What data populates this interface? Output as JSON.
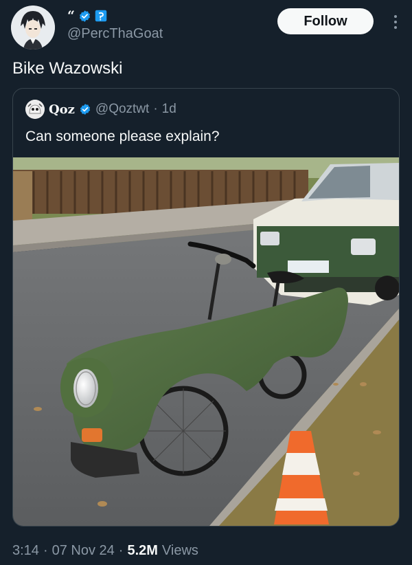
{
  "post": {
    "author_handle": "@PercThaGoat",
    "badge_glyph": "“",
    "follow_label": "Follow",
    "text": "Bike Wazowski",
    "avatar_icon": "anime-character-avatar",
    "verified_icon": "verified-badge-icon",
    "affiliate_icon": "affiliate-badge-icon",
    "more_icon": "more-vertical-icon"
  },
  "quoted": {
    "display_name": "Qoz",
    "handle": "@Qoztwt",
    "separator": "·",
    "age": "1d",
    "text": "Can someone please explain?",
    "image_icon": "car-front-bike-photo"
  },
  "footer": {
    "time": "3:14",
    "sep1": "·",
    "date": "07 Nov 24",
    "sep2": "·",
    "views_count": "5.2M",
    "views_label": "Views"
  },
  "colors": {
    "background": "#15202b",
    "text": "#f7f9f9",
    "secondary_text": "#8b98a5",
    "verified_blue": "#1d9bf0",
    "border": "#38444d"
  }
}
